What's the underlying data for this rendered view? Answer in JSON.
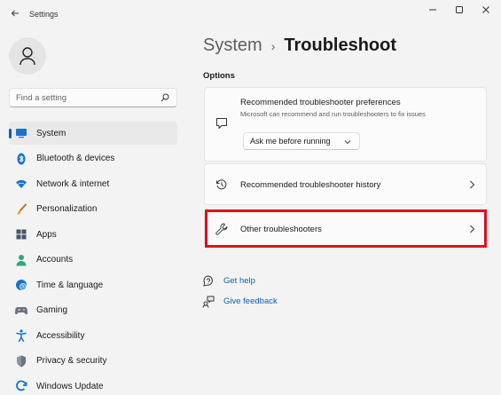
{
  "window": {
    "title": "Settings",
    "controls": {
      "minimize": "minimize-icon",
      "maximize": "maximize-icon",
      "close": "close-icon"
    }
  },
  "search": {
    "placeholder": "Find a setting"
  },
  "sidebar": {
    "items": [
      {
        "label": "System",
        "icon": "system-icon",
        "active": true
      },
      {
        "label": "Bluetooth & devices",
        "icon": "bluetooth-icon"
      },
      {
        "label": "Network & internet",
        "icon": "wifi-icon"
      },
      {
        "label": "Personalization",
        "icon": "brush-icon"
      },
      {
        "label": "Apps",
        "icon": "apps-icon"
      },
      {
        "label": "Accounts",
        "icon": "accounts-icon"
      },
      {
        "label": "Time & language",
        "icon": "globe-clock-icon"
      },
      {
        "label": "Gaming",
        "icon": "gamepad-icon"
      },
      {
        "label": "Accessibility",
        "icon": "accessibility-icon"
      },
      {
        "label": "Privacy & security",
        "icon": "shield-icon"
      },
      {
        "label": "Windows Update",
        "icon": "update-icon"
      }
    ]
  },
  "breadcrumb": {
    "parent": "System",
    "separator": "›",
    "current": "Troubleshoot"
  },
  "main": {
    "section_label": "Options",
    "cards": {
      "preferences": {
        "title": "Recommended troubleshooter preferences",
        "subtitle": "Microsoft can recommend and run troubleshooters to fix issues",
        "dropdown_value": "Ask me before running",
        "icon": "chat-icon"
      },
      "history": {
        "title": "Recommended troubleshooter history",
        "icon": "history-icon"
      },
      "other": {
        "title": "Other troubleshooters",
        "icon": "wrench-icon"
      }
    },
    "links": {
      "help": {
        "label": "Get help",
        "icon": "help-icon"
      },
      "feedback": {
        "label": "Give feedback",
        "icon": "feedback-icon"
      }
    }
  },
  "colors": {
    "accent": "#005fb8",
    "link": "#0d5fb4",
    "highlight": "#e0101e",
    "background": "#f3f3f3",
    "card": "#fbfbfb"
  }
}
